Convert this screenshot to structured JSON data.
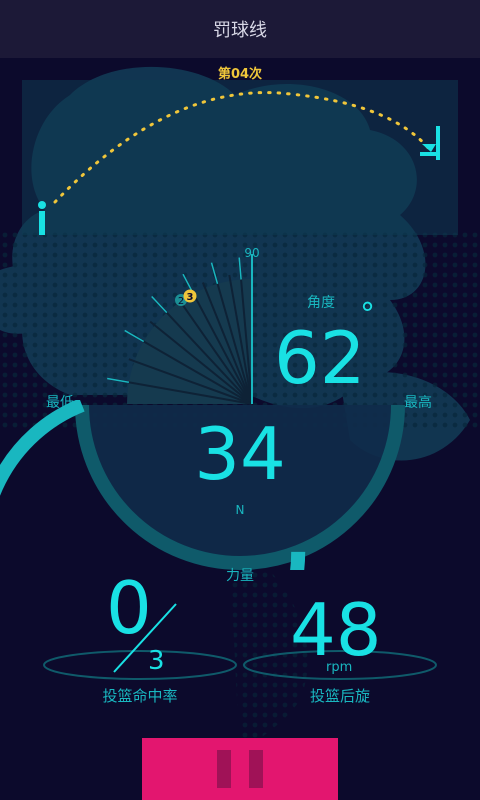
{
  "header": {
    "title": "罚球线"
  },
  "attempt": {
    "label": "第04次"
  },
  "angle_dial": {
    "tick_90": "90",
    "marker_2": "2",
    "marker_3": "3",
    "label": "角度",
    "value": "62",
    "unit": "°",
    "min_label": "最低",
    "max_label": "最高"
  },
  "force": {
    "value": "34",
    "unit": "N",
    "label": "力量",
    "level": 0.62
  },
  "hit_rate": {
    "made": "0",
    "total": "3",
    "label": "投篮命中率"
  },
  "spin": {
    "value": "48",
    "unit": "rpm",
    "label": "投篮后旋"
  },
  "controls": {
    "pause_icon": "pause-icon"
  },
  "colors": {
    "background": "#0c0a2c",
    "accent": "#19e1e4",
    "trajectory": "#f0c63a",
    "pause_button": "#e3166f"
  }
}
